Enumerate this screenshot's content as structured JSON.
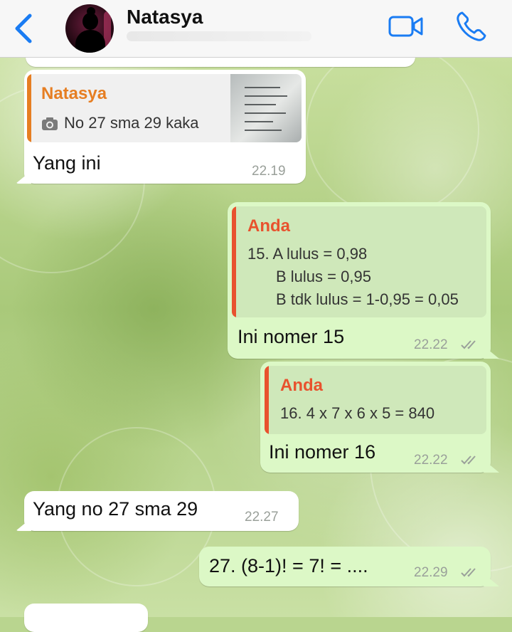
{
  "header": {
    "contact_name": "Natasya",
    "back_icon": "chevron-left-icon",
    "video_icon": "video-call-icon",
    "phone_icon": "phone-call-icon",
    "accent_color": "#1a7cf3"
  },
  "messages": [
    {
      "direction": "incoming",
      "quote": {
        "author": "Natasya",
        "author_color": "#e67e22",
        "text": "No 27 sma 29 kaka",
        "media_icon": "camera-icon"
      },
      "text": "Yang ini",
      "time": "22.19"
    },
    {
      "direction": "outgoing",
      "quote": {
        "author": "Anda",
        "author_color": "#e8522e",
        "lines": [
          "15. A lulus = 0,98",
          "B lulus = 0,95",
          "B tdk lulus = 1-0,95 = 0,05"
        ]
      },
      "text": "Ini nomer 15",
      "time": "22.22"
    },
    {
      "direction": "outgoing",
      "quote": {
        "author": "Anda",
        "author_color": "#e8522e",
        "lines": [
          "16. 4 x 7 x 6 x 5 = 840"
        ]
      },
      "text": "Ini nomer 16",
      "time": "22.22"
    },
    {
      "direction": "incoming",
      "text": "Yang no 27 sma 29",
      "time": "22.27"
    },
    {
      "direction": "outgoing",
      "text": "27. (8-1)! = 7! = ....",
      "time": "22.29"
    }
  ]
}
